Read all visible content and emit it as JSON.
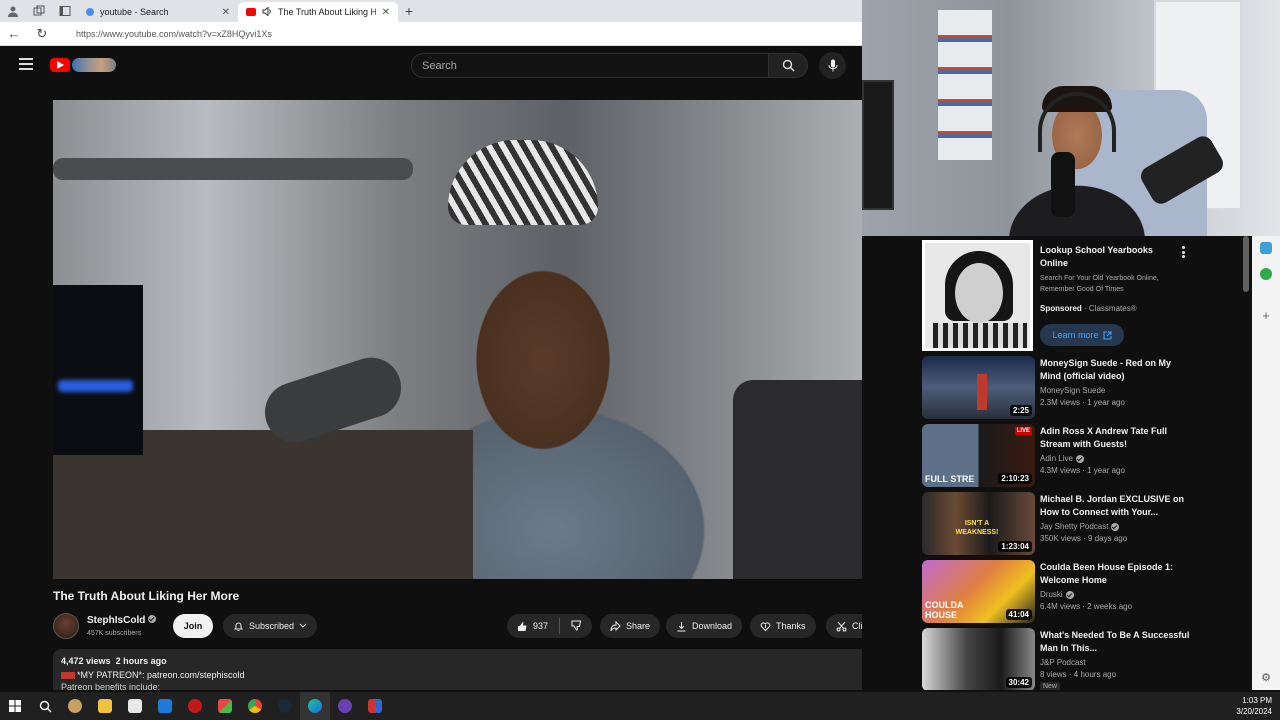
{
  "browser": {
    "tabs": [
      {
        "title": "youtube - Search",
        "active": false
      },
      {
        "title": "The Truth About Liking Her",
        "active": true
      }
    ],
    "url": "https://www.youtube.com/watch?v=xZ8HQyvi1Xs"
  },
  "youtube": {
    "search_placeholder": "Search",
    "video": {
      "title": "The Truth About Liking Her More",
      "channel": "StephIsCold",
      "subscribers": "457K subscribers",
      "join_label": "Join",
      "subscribed_label": "Subscribed",
      "likes": "937",
      "share_label": "Share",
      "download_label": "Download",
      "thanks_label": "Thanks",
      "clip_label": "Clip"
    },
    "description": {
      "views": "4,472 views",
      "time": "2 hours ago",
      "line1": "*MY PATREON*: patreon.com/stephiscold",
      "line2": "Patreon benefits include:"
    },
    "ad": {
      "title": "Lookup School Yearbooks Online",
      "desc": "Search For Your Old Yearbook Online, Remember Good Of Times",
      "sponsored": "Sponsored",
      "advertiser": "· Classmates®",
      "cta": "Learn more"
    },
    "recommendations": [
      {
        "title": "MoneySign Suede - Red on My Mind (official video)",
        "channel": "MoneySign Suede",
        "verified": false,
        "meta": "2.3M views · 1 year ago",
        "duration": "2:25"
      },
      {
        "title": "Adin Ross X Andrew Tate Full Stream with Guests!",
        "channel": "Adin Live",
        "verified": true,
        "meta": "4.3M views · 1 year ago",
        "duration": "2:10:23",
        "badge": "LIVE",
        "caption": "FULL STRE"
      },
      {
        "title": "Michael B. Jordan EXCLUSIVE on How to Connect with Your...",
        "channel": "Jay Shetty Podcast",
        "verified": true,
        "meta": "350K views · 9 days ago",
        "duration": "1:23:04",
        "caption": "ISN'T A WEAKNESS!"
      },
      {
        "title": "Coulda Been House Episode 1: Welcome Home",
        "channel": "Druski",
        "verified": true,
        "meta": "6.4M views · 2 weeks ago",
        "duration": "41:04",
        "caption": "COULDA HOUSE"
      },
      {
        "title": "What's Needed To Be A Successful Man In This...",
        "channel": "J&P Podcast",
        "verified": false,
        "meta": "8 views · 4 hours ago",
        "duration": "30:42",
        "new": "New"
      }
    ]
  },
  "taskbar": {
    "time": "1:03 PM",
    "date": "3/20/2024"
  },
  "colors": {
    "yt_bg": "#0f0f0f",
    "yt_red": "#ff0000",
    "pill_bg": "#272727",
    "link_blue": "#3ea6ff"
  }
}
